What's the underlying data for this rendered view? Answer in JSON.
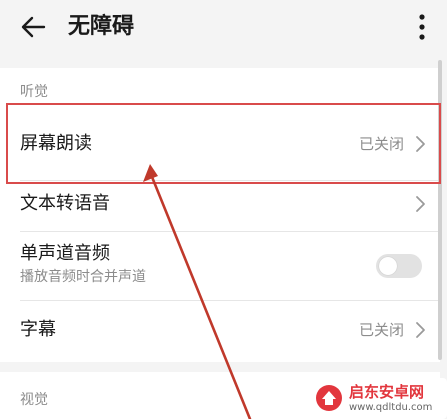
{
  "header": {
    "title": "无障碍"
  },
  "sections": {
    "hearing": {
      "header": "听觉",
      "items": [
        {
          "label": "屏幕朗读",
          "value": "已关闭"
        },
        {
          "label": "文本转语音"
        },
        {
          "label": "单声道音频",
          "sublabel": "播放音频时合并声道",
          "toggle_on": false
        },
        {
          "label": "字幕",
          "value": "已关闭"
        }
      ]
    },
    "vision": {
      "header": "视觉"
    }
  },
  "watermark": {
    "name": "启东安卓网",
    "url": "www.qdltdu.com"
  },
  "colors": {
    "annotation_red": "#d94b4b",
    "watermark_red": "#e2363d"
  },
  "icons": [
    "arrow-left-icon",
    "more-vertical-icon",
    "chevron-right-icon"
  ]
}
